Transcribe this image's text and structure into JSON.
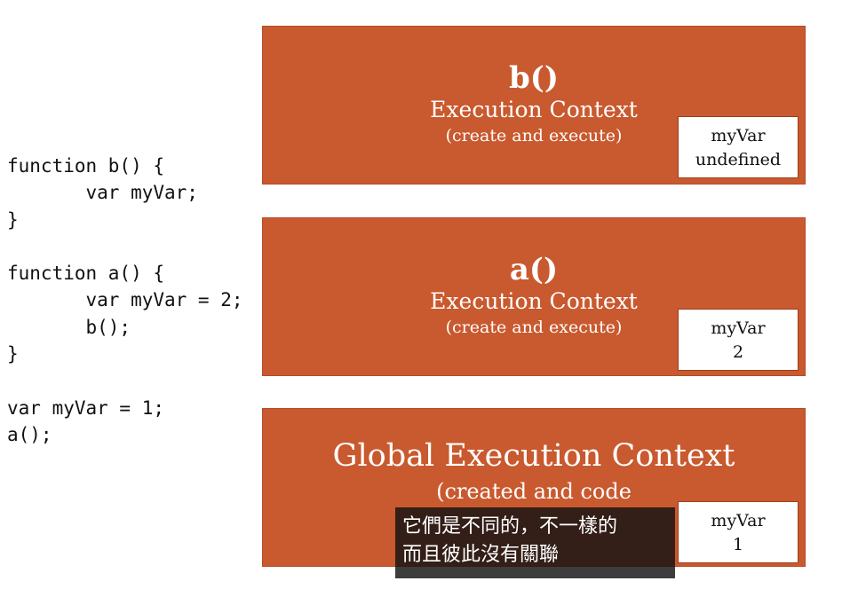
{
  "code": {
    "lines": [
      "function b() {",
      "       var myVar;",
      "}",
      "",
      "function a() {",
      "       var myVar = 2;",
      "       b();",
      "}",
      "",
      "var myVar = 1;",
      "a();"
    ]
  },
  "contexts": {
    "b": {
      "name": "b()",
      "label": "Execution Context",
      "sub": "(create and execute)",
      "var_name": "myVar",
      "var_value": "undefined"
    },
    "a": {
      "name": "a()",
      "label": "Execution Context",
      "sub": "(create and execute)",
      "var_name": "myVar",
      "var_value": "2"
    },
    "global": {
      "label": "Global Execution Context",
      "sub": "(created and code",
      "var_name": "myVar",
      "var_value": "1"
    }
  },
  "subtitle": {
    "line1": "它們是不同的，不一樣的",
    "line2": "而且彼此沒有關聯"
  },
  "colors": {
    "context_fill": "#c9592e",
    "var_box": "#ffffff",
    "subtitle_bg": "#121212"
  }
}
